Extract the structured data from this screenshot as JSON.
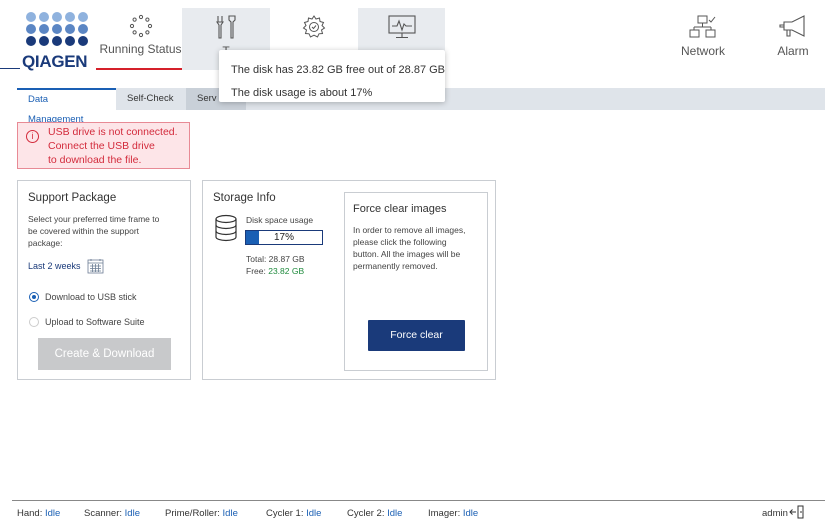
{
  "brand": {
    "logo_text": "QIAGEN",
    "colors": {
      "primary": "#1a3a7a",
      "accent": "#1a5fb4",
      "alert": "#d32b3c",
      "brand_red": "#d5202a"
    }
  },
  "nav": {
    "running_status": {
      "label": "Running Status",
      "icon": "running-status-icon"
    },
    "tools": {
      "label": "T",
      "icon": "tools-icon"
    },
    "settings": {
      "icon": "gear-icon"
    },
    "monitor": {
      "icon": "monitor-icon"
    },
    "network": {
      "label": "Network",
      "icon": "network-icon"
    },
    "alarm": {
      "label": "Alarm",
      "icon": "megaphone-icon"
    }
  },
  "tooltip": {
    "line1": "The disk has 23.82 GB free out of 28.87 GB",
    "line2": "The disk usage is about 17%"
  },
  "subtabs": [
    {
      "label": "Data Management"
    },
    {
      "label": "Self-Check"
    },
    {
      "label": "Serv"
    }
  ],
  "alert": {
    "line1": "USB drive is not connected.",
    "line2": "Connect the USB drive",
    "line3": "to download the file."
  },
  "support": {
    "title": "Support Package",
    "desc1": "Select your preferred time frame to",
    "desc2": "be covered within the support",
    "desc3": "package:",
    "timeframe": "Last 2 weeks",
    "option_usb": "Download to USB stick",
    "option_suite": "Upload to Software Suite",
    "button": "Create & Download"
  },
  "storage": {
    "title": "Storage Info",
    "disk_label": "Disk space usage",
    "usage_percent": 17,
    "usage_text": "17%",
    "total": "Total: 28.87 GB",
    "free_label": "Free:",
    "free_value": "23.82 GB"
  },
  "force_clear": {
    "title": "Force clear images",
    "desc1": "In order to remove all images,",
    "desc2": "please click the following",
    "desc3": "button. All the images will be",
    "desc4": "permanently removed.",
    "button": "Force clear"
  },
  "footer": {
    "hand_label": "Hand:",
    "hand_status": "Idle",
    "scanner_label": "Scanner:",
    "scanner_status": "Idle",
    "prime_label": "Prime/Roller:",
    "prime_status": "Idle",
    "cycler1_label": "Cycler 1:",
    "cycler1_status": "Idle",
    "cycler2_label": "Cycler 2:",
    "cycler2_status": "Idle",
    "imager_label": "Imager:",
    "imager_status": "Idle",
    "user": "admin",
    "logout_icon": "logout-icon"
  }
}
